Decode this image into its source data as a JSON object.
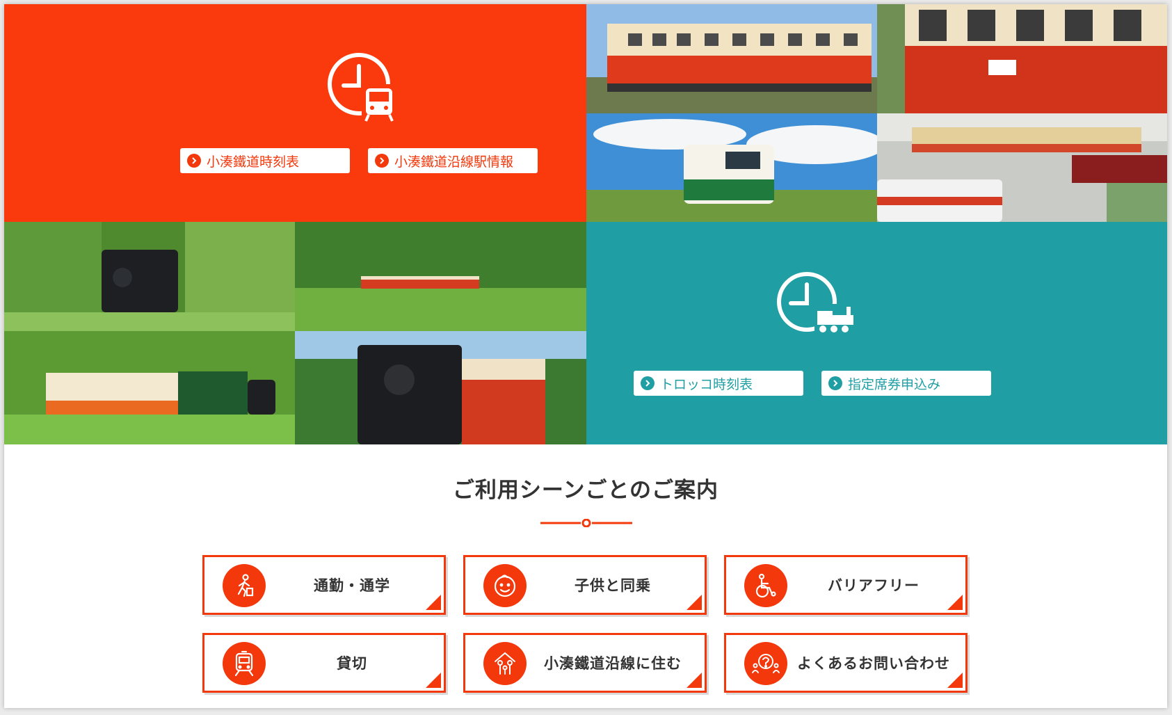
{
  "timetable_panel": {
    "buttons": [
      {
        "label": "小湊鐵道時刻表"
      },
      {
        "label": "小湊鐵道沿線駅情報"
      }
    ]
  },
  "trolley_panel": {
    "buttons": [
      {
        "label": "トロッコ時刻表"
      },
      {
        "label": "指定席券申込み"
      }
    ]
  },
  "scenes": {
    "title": "ご利用シーンごとのご案内",
    "cards": [
      {
        "label": "通勤・通学",
        "icon": "commuter-icon"
      },
      {
        "label": "子供と同乗",
        "icon": "child-face-icon"
      },
      {
        "label": "バリアフリー",
        "icon": "wheelchair-icon"
      },
      {
        "label": "貸切",
        "icon": "train-front-icon"
      },
      {
        "label": "小湊鐵道沿線に住む",
        "icon": "family-icon"
      },
      {
        "label": "よくあるお問い合わせ",
        "icon": "question-people-icon"
      }
    ]
  },
  "colors": {
    "brand_orange": "#fa3a0c",
    "brand_teal": "#1f9fa4",
    "heading_text": "#333333"
  }
}
